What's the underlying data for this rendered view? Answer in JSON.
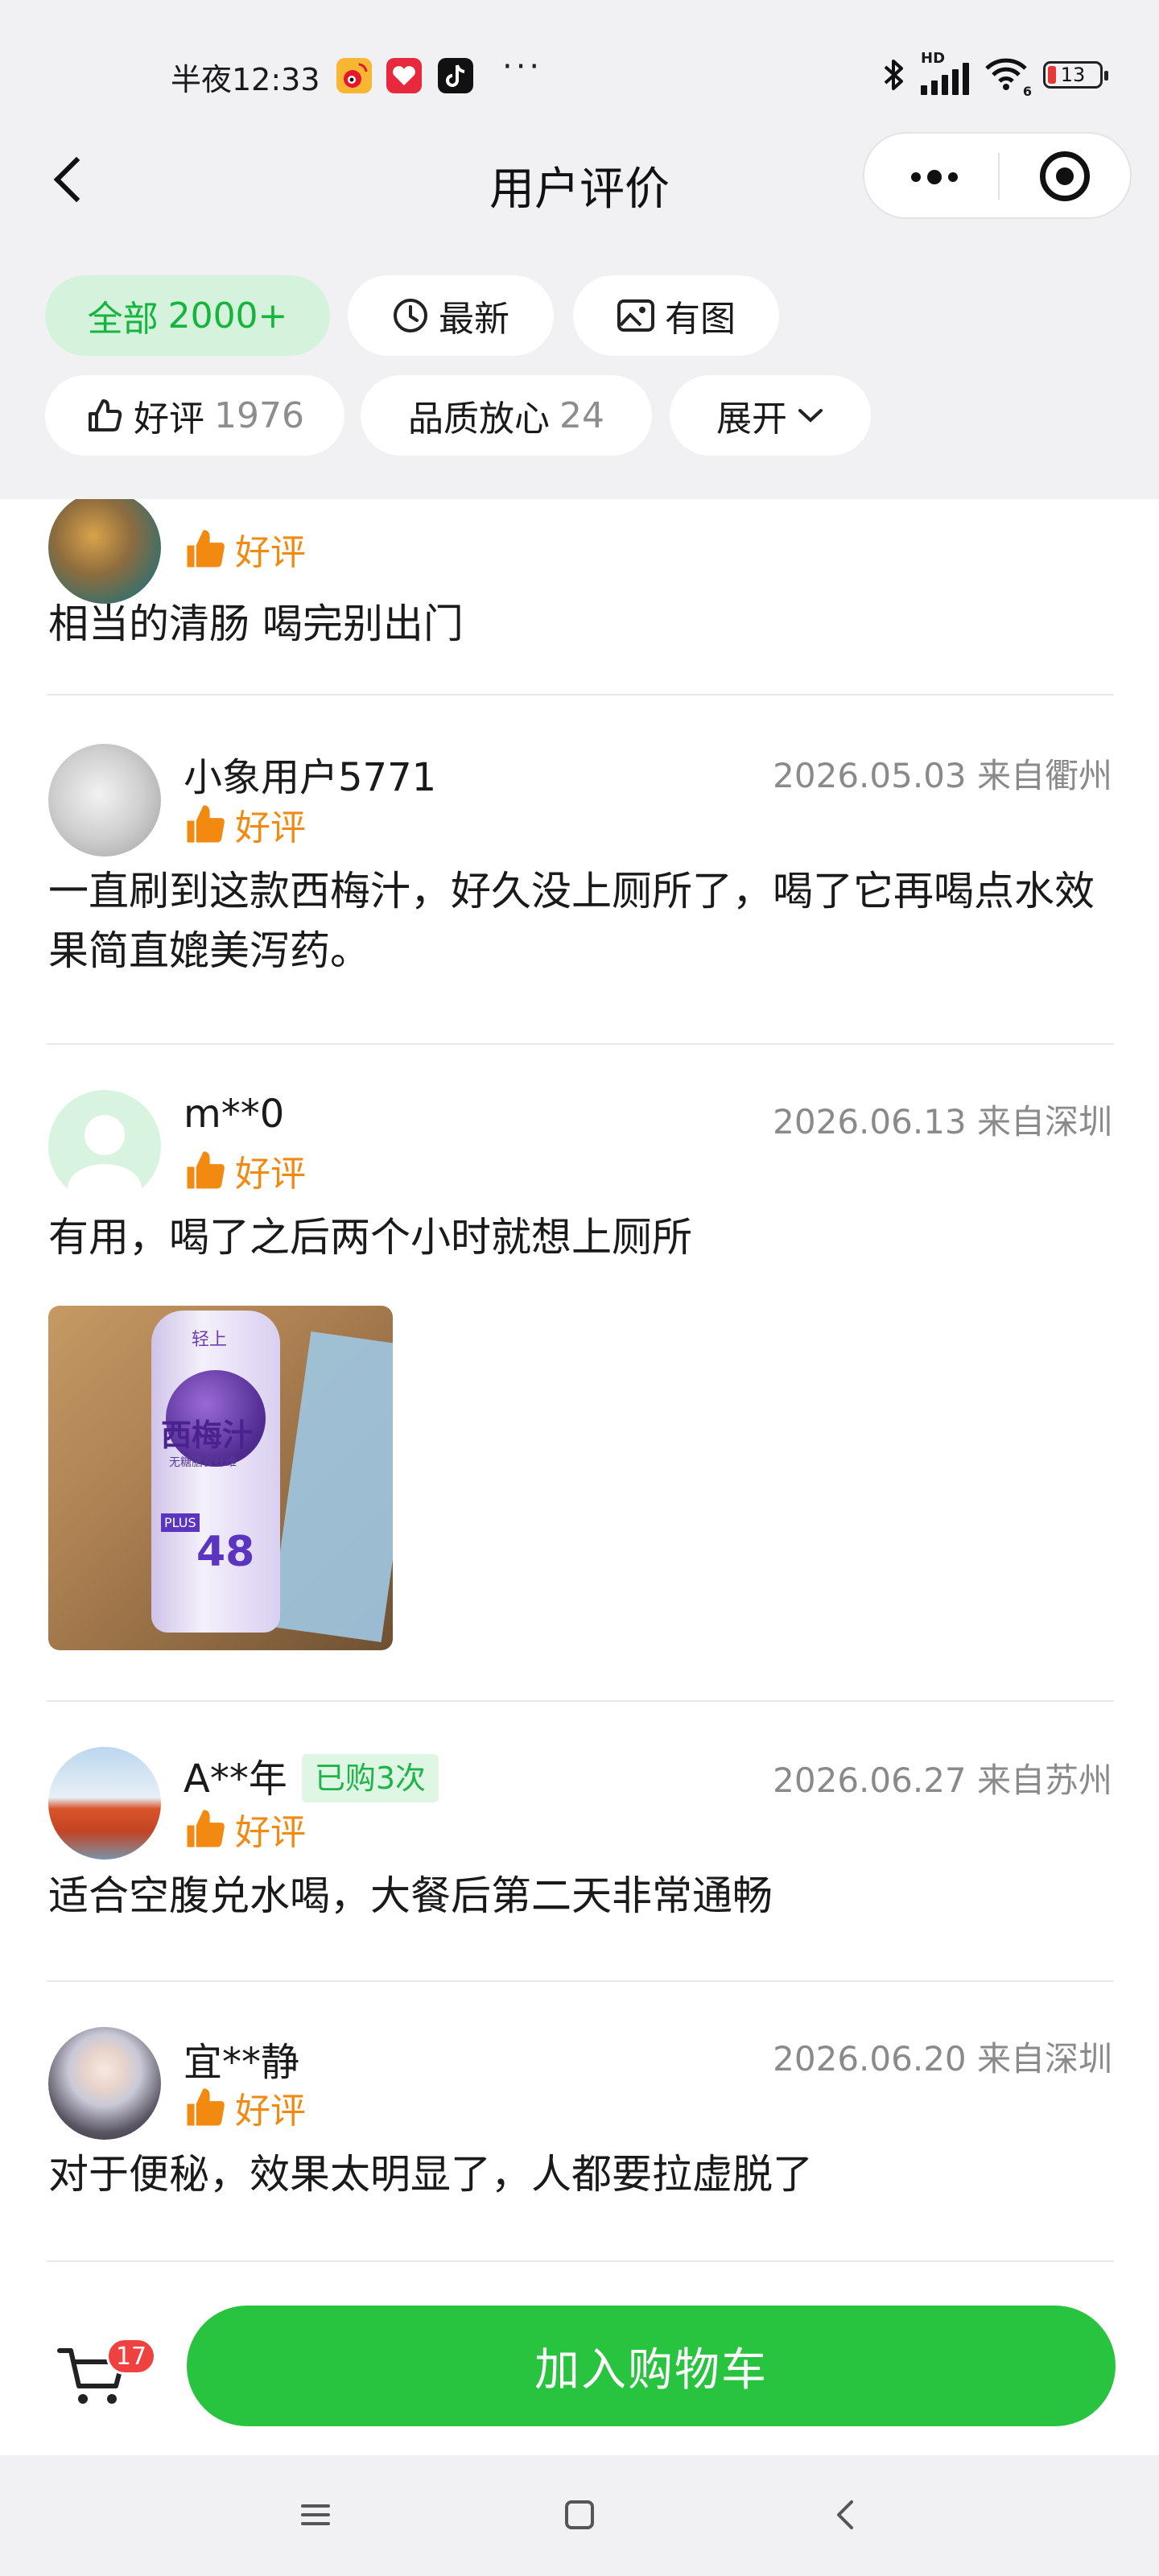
{
  "status_bar": {
    "time": "半夜12:33",
    "more": "···",
    "hd_label": "HD",
    "wifi_label": "6",
    "battery": "13"
  },
  "header": {
    "title": "用户评价"
  },
  "filters": [
    {
      "label": "全部",
      "count": "2000+"
    },
    {
      "label": "最新",
      "count": ""
    },
    {
      "label": "有图",
      "count": ""
    },
    {
      "label": "好评",
      "count": "1976"
    },
    {
      "label": "品质放心",
      "count": "24"
    },
    {
      "label": "展开",
      "count": ""
    }
  ],
  "reviews": [
    {
      "user": "",
      "badge": "",
      "date": "",
      "rating": "好评",
      "text": "相当的清肠 喝完别出门"
    },
    {
      "user": "小象用户5771",
      "badge": "",
      "date": "2026.05.03 来自衢州",
      "rating": "好评",
      "text": "一直刷到这款西梅汁，好久没上厕所了，喝了它再喝点水效果简直媲美泻药。"
    },
    {
      "user": "m**0",
      "badge": "",
      "date": "2026.06.13 来自深圳",
      "rating": "好评",
      "text": "有用，喝了之后两个小时就想上厕所"
    },
    {
      "user": "A**年",
      "badge": "已购3次",
      "date": "2026.06.27 来自苏州",
      "rating": "好评",
      "text": "适合空腹兑水喝，大餐后第二天非常通畅"
    },
    {
      "user": "宜**静",
      "badge": "",
      "date": "2026.06.20 来自深圳",
      "rating": "好评",
      "text": "对于便秘，效果太明显了，人都要拉虚脱了"
    }
  ],
  "photo_labels": {
    "brand": "轻上",
    "name": "西梅汁",
    "sub": "无糖膳食纤维",
    "tag": "PLUS",
    "number": "48"
  },
  "bottom": {
    "cart_count": "17",
    "add_to_cart": "加入购物车"
  },
  "colors": {
    "brand_green": "#28c33f",
    "active_chip_bg": "#d4f2dc",
    "rating_orange": "#f28a12",
    "badge_red": "#f04141"
  }
}
